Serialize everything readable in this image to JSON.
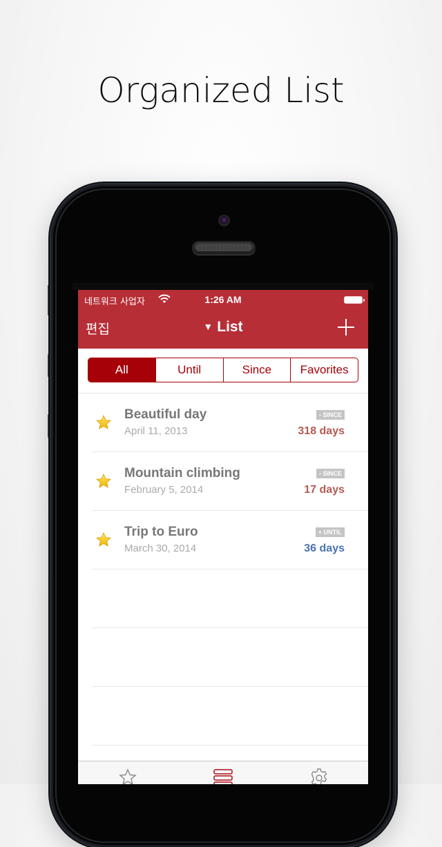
{
  "headline": "Organized List",
  "status_bar": {
    "carrier": "네트워크 사업자",
    "time": "1:26 AM",
    "wifi_icon": "wifi-icon",
    "battery_icon": "battery-full-icon"
  },
  "nav": {
    "edit_label": "편집",
    "title": "List",
    "title_icon": "triangle-down-icon",
    "add_icon": "plus-icon"
  },
  "segments": [
    {
      "label": "All",
      "active": true
    },
    {
      "label": "Until",
      "active": false
    },
    {
      "label": "Since",
      "active": false
    },
    {
      "label": "Favorites",
      "active": false
    }
  ],
  "items": [
    {
      "title": "Beautiful day",
      "date": "April 11, 2013",
      "badge": "- SINCE",
      "days": "318 days",
      "type": "since",
      "favorite": true
    },
    {
      "title": "Mountain climbing",
      "date": "February 5, 2014",
      "badge": "- SINCE",
      "days": "17 days",
      "type": "since",
      "favorite": true
    },
    {
      "title": "Trip to Euro",
      "date": "March 30, 2014",
      "badge": "+ UNTIL",
      "days": "36 days",
      "type": "until",
      "favorite": true
    }
  ],
  "colors": {
    "brand": "#b72e36",
    "segment_accent": "#a60008",
    "since": "#b45a52",
    "until": "#4a72b4",
    "badge": "#c4c4c4"
  },
  "tab_bar": [
    {
      "icon": "star-outline-icon",
      "active": false
    },
    {
      "icon": "list-icon",
      "active": true
    },
    {
      "icon": "gear-icon",
      "active": false
    }
  ]
}
